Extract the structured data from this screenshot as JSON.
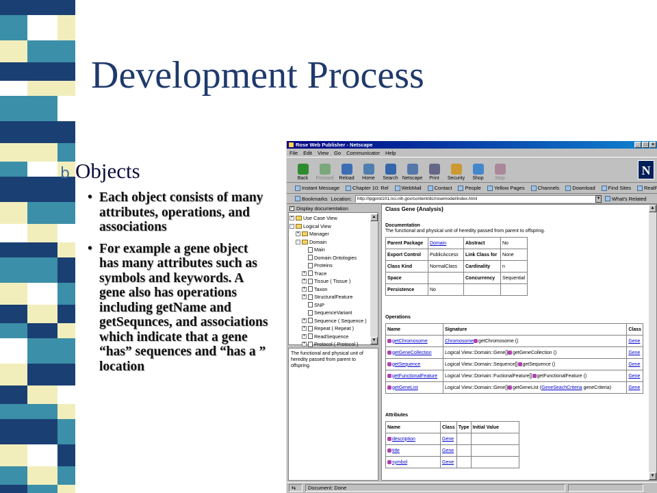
{
  "slide": {
    "title": "Development Process",
    "bullet": "Objects",
    "bullet_marker": "b",
    "sub_bullets": [
      "Each object consists of many attributes, operations, and associations",
      "For example a gene object has many attributes such as symbols and keywords. A gene also has operations including getName and getSequnces, and associations which indicate that a gene “has” sequences and “has a ” location"
    ],
    "colors": {
      "title": "#1f3a6b",
      "strip_dark": "#1a3f73",
      "strip_teal": "#3c8fa8",
      "strip_cream": "#f2eebc"
    }
  },
  "browser": {
    "title": "Rose Web Publisher - Netscape",
    "menu": [
      "File",
      "Edit",
      "View",
      "Go",
      "Communicator",
      "Help"
    ],
    "toolbar": [
      {
        "label": "Back",
        "icon": "back-arrow-icon"
      },
      {
        "label": "Forward",
        "icon": "forward-arrow-icon"
      },
      {
        "label": "Reload",
        "icon": "reload-icon"
      },
      {
        "label": "Home",
        "icon": "home-icon"
      },
      {
        "label": "Search",
        "icon": "search-icon"
      },
      {
        "label": "Netscape",
        "icon": "netscape-icon"
      },
      {
        "label": "Print",
        "icon": "print-icon"
      },
      {
        "label": "Security",
        "icon": "lock-icon"
      },
      {
        "label": "Shop",
        "icon": "shop-icon"
      },
      {
        "label": "Stop",
        "icon": "stop-icon"
      }
    ],
    "personal_bar": [
      "Instant Message",
      "Chapter 10: Rel",
      "WebMail",
      "Contact",
      "People",
      "Yellow Pages",
      "Channels",
      "Download",
      "Find Sites",
      "RealPlayer"
    ],
    "bookmarks_label": "Bookmarks",
    "location_label": "Location:",
    "url": "http://lpgprot101.nci.nih.gov/content/dc/rosemodel/index.html",
    "whats_related": "What's Related",
    "status": "Document: Done"
  },
  "tree": {
    "header": "Display documentation",
    "nodes": [
      {
        "label": "Use Case View",
        "depth": 0,
        "kind": "folder",
        "toggle": "+"
      },
      {
        "label": "Logical View",
        "depth": 0,
        "kind": "folder",
        "toggle": "-"
      },
      {
        "label": "Manager",
        "depth": 1,
        "kind": "folder",
        "toggle": "+"
      },
      {
        "label": "Domain",
        "depth": 1,
        "kind": "folder",
        "toggle": "-"
      },
      {
        "label": "Main",
        "depth": 2,
        "kind": "doc",
        "toggle": ""
      },
      {
        "label": "Domain Ontologies",
        "depth": 2,
        "kind": "doc",
        "toggle": ""
      },
      {
        "label": "Proteins",
        "depth": 2,
        "kind": "doc",
        "toggle": ""
      },
      {
        "label": "Trace",
        "depth": 2,
        "kind": "doc",
        "toggle": "+"
      },
      {
        "label": "Tissue ( Tissue )",
        "depth": 2,
        "kind": "doc",
        "toggle": "+"
      },
      {
        "label": "Taxon",
        "depth": 2,
        "kind": "doc",
        "toggle": "+"
      },
      {
        "label": "StructuralFeature",
        "depth": 2,
        "kind": "doc",
        "toggle": "+"
      },
      {
        "label": "SNP",
        "depth": 2,
        "kind": "doc",
        "toggle": ""
      },
      {
        "label": "SequenceVariant",
        "depth": 2,
        "kind": "doc",
        "toggle": ""
      },
      {
        "label": "Sequence ( Sequence )",
        "depth": 2,
        "kind": "doc",
        "toggle": "+"
      },
      {
        "label": "Repeat ( Repeat )",
        "depth": 2,
        "kind": "doc",
        "toggle": "+"
      },
      {
        "label": "ReadSequence",
        "depth": 2,
        "kind": "doc",
        "toggle": "+"
      },
      {
        "label": "Protocol ( Protocol )",
        "depth": 2,
        "kind": "doc",
        "toggle": "+"
      }
    ],
    "description": "The functional and physical unit of heredity passed from parent to offspring."
  },
  "main": {
    "class_title": "Class Gene {Analysis}",
    "doc_heading": "Documentation",
    "doc_text": "The functional and physical unit of heredity passed from parent to offspring.",
    "props": [
      {
        "k1": "Parent Package",
        "v1": "Domain",
        "k2": "Abstract",
        "v2": "No"
      },
      {
        "k1": "Export Control",
        "v1": "PublicAccess",
        "k2": "Link Class for",
        "v2": "None"
      },
      {
        "k1": "Class Kind",
        "v1": "NormalClass",
        "k2": "Cardinality",
        "v2": "n"
      },
      {
        "k1": "Space",
        "v1": "",
        "k2": "Concurrency",
        "v2": "Sequential"
      },
      {
        "k1": "Persistence",
        "v1": "No",
        "k2": "",
        "v2": ""
      }
    ],
    "ops_heading": "Operations",
    "ops_cols": [
      "Name",
      "Signature",
      "Class"
    ],
    "ops": [
      {
        "name": "getChromosome",
        "sig_type": "Chromosome",
        "sig_call": "getChromosome ()",
        "cls": "Gene"
      },
      {
        "name": "getGeneCollection",
        "sig_type": "Logical View::Domain::Gene[]",
        "sig_call": "getGeneCollection ()",
        "cls": "Gene"
      },
      {
        "name": "getSequence",
        "sig_type": "Logical View::Domain::Sequence[]",
        "sig_call": "getSequence ()",
        "cls": "Gene"
      },
      {
        "name": "getFunctionalFeature",
        "sig_type": "Logical View::Domain::FuctionalFeature[]",
        "sig_call": "getFunctionalFeature ()",
        "cls": "Gene"
      },
      {
        "name": "getGeneList",
        "sig_type": "Logical View::Domain::Gene[]",
        "sig_call": "getGeneList (",
        "sig_link": "GeneSeachCriteria",
        "sig_tail": " geneCriteria)",
        "cls": "Gene"
      }
    ],
    "attrs_heading": "Attributes",
    "attr_cols": [
      "Name",
      "Class",
      "Type",
      "Initial Value"
    ],
    "attrs": [
      {
        "name": "description",
        "cls": "Gene"
      },
      {
        "name": "title",
        "cls": "Gene"
      },
      {
        "name": "symbol",
        "cls": "Gene"
      }
    ]
  }
}
